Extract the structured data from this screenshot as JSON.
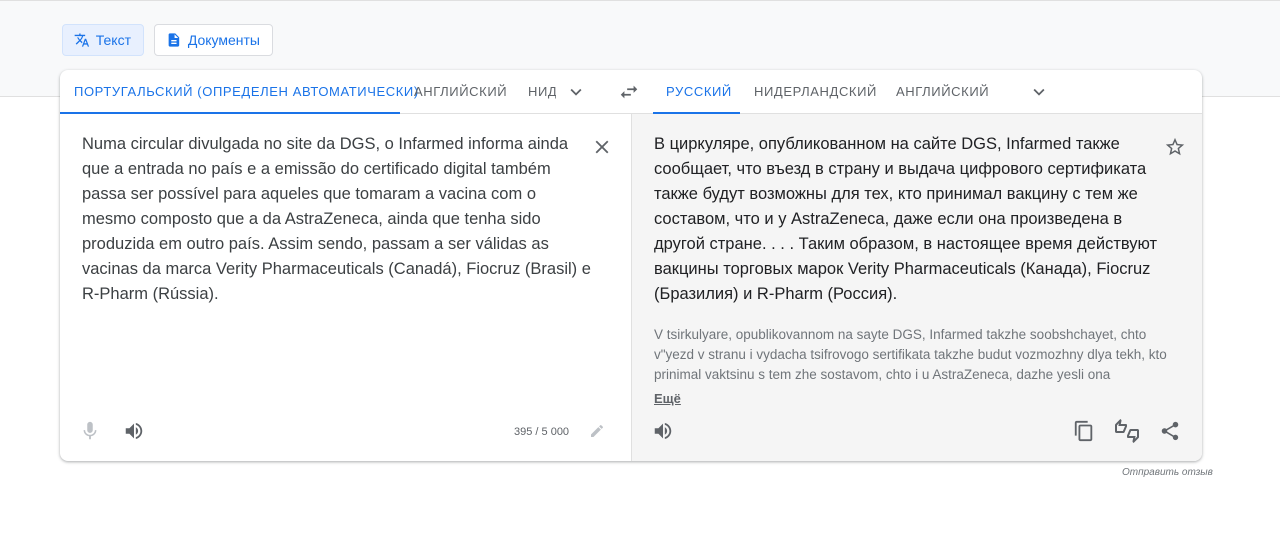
{
  "modes": {
    "text": "Текст",
    "documents": "Документы"
  },
  "source_langs": [
    "Португальский (определен автоматически)",
    "Английский",
    "Нид"
  ],
  "target_langs": [
    "Русский",
    "Нидерландский",
    "Английский"
  ],
  "source_text": "Numa circular divulgada no site da DGS, o Infarmed informa ainda que a entrada no país e a emissão do certificado digital também passa ser possível para aqueles que tomaram a vacina com o mesmo composto que a da AstraZeneca, ainda que tenha sido produzida em outro país. Assim sendo, passam a ser válidas as vacinas da marca Verity Pharmaceuticals (Canadá), Fiocruz (Brasil) e R-Pharm (Rússia).",
  "translation": "В циркуляре, опубликованном на сайте DGS, Infarmed также сообщает, что въезд в страну и выдача цифрового сертификата также будут возможны для тех, кто принимал вакцину с тем же составом, что и у AstraZeneca, даже если она произведена в другой стране. . . . Таким образом, в настоящее время действуют вакцины торговых марок Verity Pharmaceuticals (Канада), Fiocruz (Бразилия) и R-Pharm (Россия).",
  "transliteration": "V tsirkulyare, opublikovannom na sayte DGS, Infarmed takzhe soobshchayet, chto v\"yezd v stranu i vydacha tsifrovogo sertifikata takzhe budut vozmozhny dlya tekh, kto prinimal vaktsinu s tem zhe sostavom, chto i u AstraZeneca, dazhe yesli ona proizvedena v",
  "more_label": "Ещё",
  "char_count": "395 / 5 000",
  "feedback": "Отправить отзыв",
  "colors": {
    "accent": "#1a73e8",
    "text": "#202124",
    "muted": "#5f6368"
  }
}
